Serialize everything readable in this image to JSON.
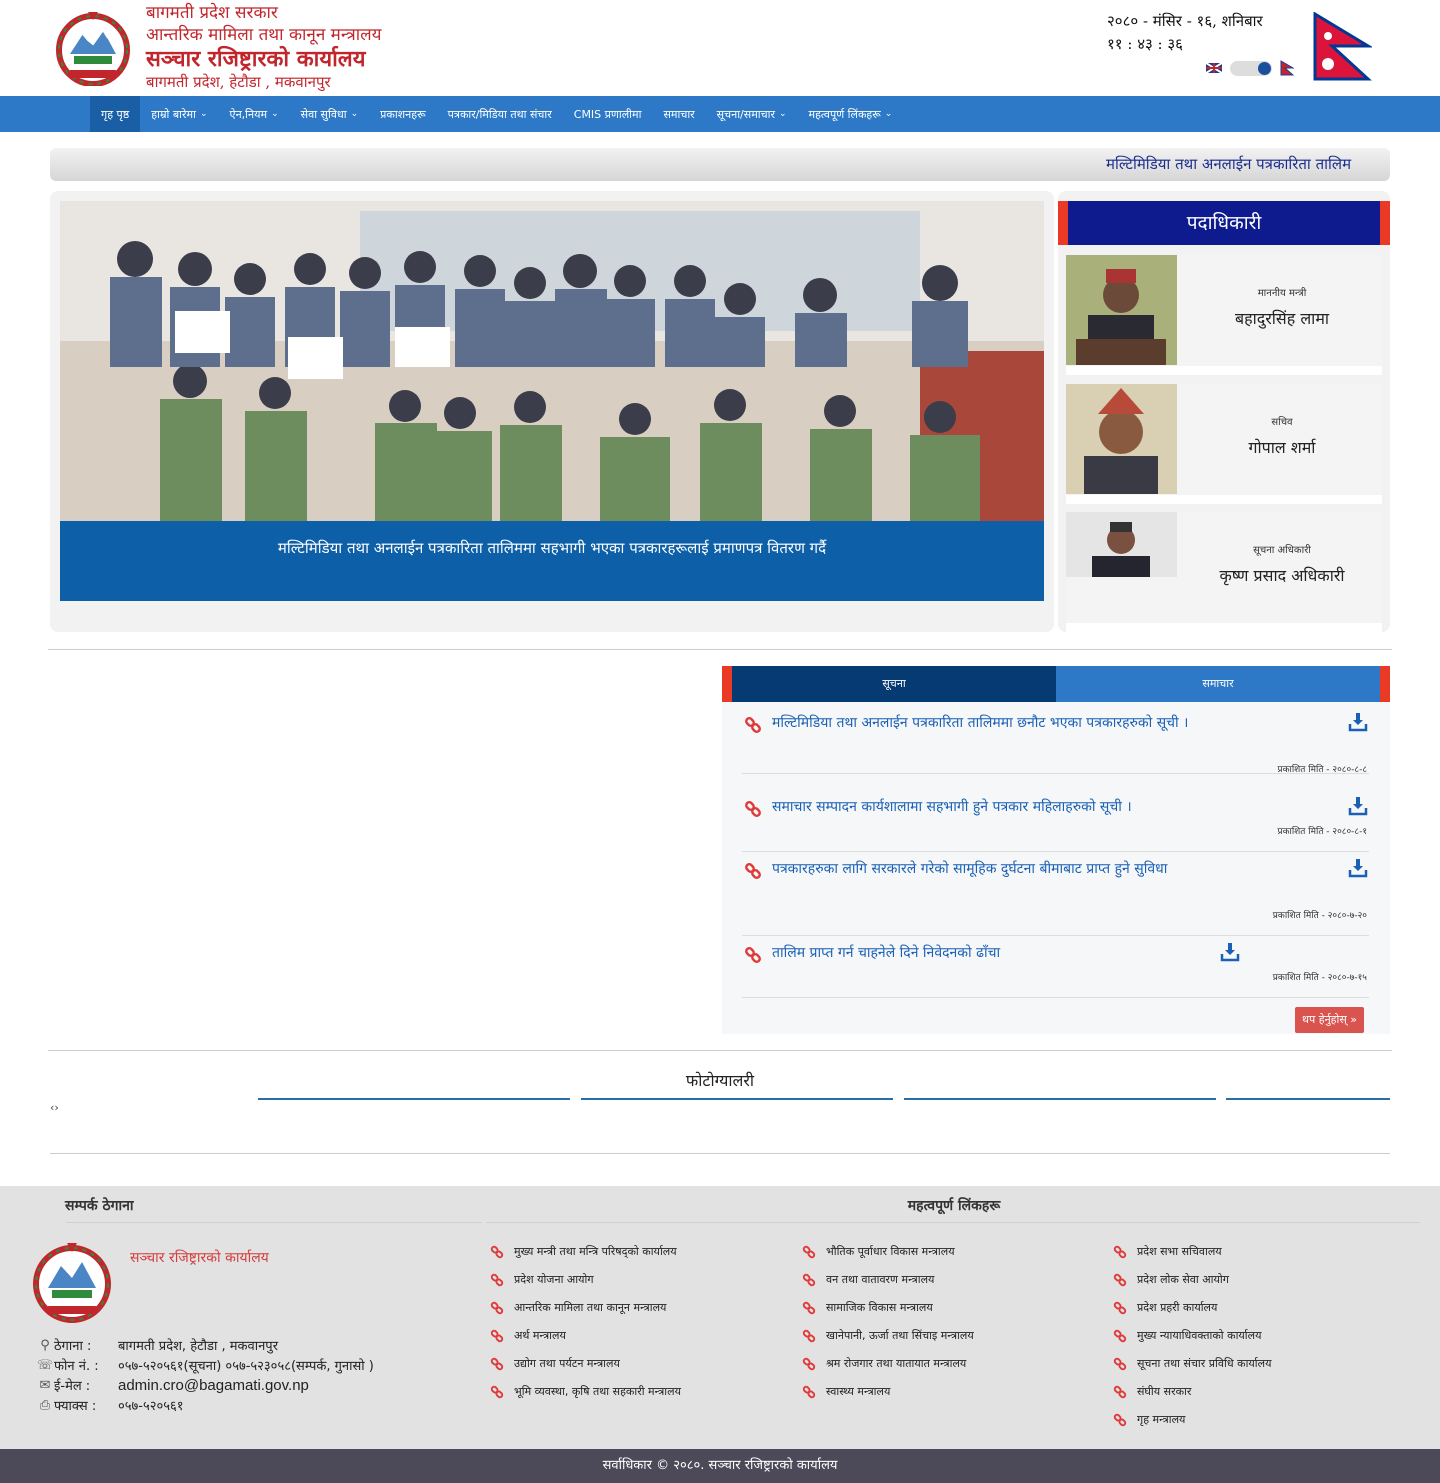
{
  "header": {
    "office_lines": [
      "बागमती प्रदेश सरकार",
      "आन्तरिक मामिला तथा कानून मन्त्रालय",
      "सञ्चार रजिष्ट्रारको कार्यालय",
      "बागमती प्रदेश, हेटौडा , मकवानपुर"
    ],
    "date": "२०८० - मंसिर - १६, शनिबार",
    "time": "११ : ४३ : ३६",
    "lang_left": "English",
    "lang_right": "नेपाली"
  },
  "nav": {
    "items": [
      {
        "label": "गृह पृष्ठ",
        "dropdown": false,
        "active": true
      },
      {
        "label": "हाम्रो बारेमा",
        "dropdown": true
      },
      {
        "label": "ऐन,नियम",
        "dropdown": true
      },
      {
        "label": "सेवा सुविधा",
        "dropdown": true
      },
      {
        "label": "प्रकाशनहरू",
        "dropdown": false
      },
      {
        "label": "पत्रकार/मिडिया तथा संचार",
        "dropdown": false
      },
      {
        "label": "CMIS प्रणालीमा",
        "dropdown": false
      },
      {
        "label": "समाचार",
        "dropdown": false
      },
      {
        "label": "सूचना/समाचार",
        "dropdown": true
      },
      {
        "label": "महत्वपूर्ण लिंकहरू",
        "dropdown": true
      }
    ]
  },
  "ticker": "मल्टिमिडिया तथा अनलाईन पत्रकारिता तालिम",
  "slider": {
    "caption": "मल्टिमिडिया तथा अनलाईन पत्रकारिता तालिममा सहभागी भएका पत्रकारहरूलाई प्रमाणपत्र वितरण गर्दै"
  },
  "officials": {
    "title": "पदाधिकारी",
    "people": [
      {
        "role": "माननीय मन्त्री",
        "name": "बहादुरसिंह लामा"
      },
      {
        "role": "सचिव",
        "name": "गोपाल शर्मा"
      },
      {
        "role": "सूचना अधिकारी",
        "name": "कृष्ण प्रसाद अधिकारी"
      }
    ]
  },
  "tabs": {
    "labels": [
      "सूचना",
      "समाचार"
    ],
    "notices": [
      {
        "title": "मल्टिमिडिया तथा अनलाईन पत्रकारिता तालिममा छनौट भएका पत्रकारहरुको सूची ।",
        "date": "प्रकाशित मिति - २०८०-८-८"
      },
      {
        "title": "समाचार सम्पादन कार्यशालामा सहभागी हुने पत्रकार महिलाहरुको सूची ।",
        "date": "प्रकाशित मिति - २०८०-८-१"
      },
      {
        "title": "पत्रकारहरुका लागि सरकारले गरेको सामूहिक दुर्घटना बीमाबाट प्राप्त हुने सुविधा",
        "date": "प्रकाशित मिति - २०८०-७-२०"
      },
      {
        "title": "तालिम प्राप्त गर्न चाहनेले दिने निवेदनको ढाँचा",
        "date": "प्रकाशित मिति - २०८०-७-१५"
      }
    ],
    "more_label": "थप हेर्नुहोस् »"
  },
  "gallery": {
    "title": "फोटोग्यालरी",
    "arrows": "‹›"
  },
  "footer": {
    "contact_title": "सम्पर्क ठेगाना",
    "links_title": "महत्वपूर्ण लिंकहरू",
    "office_name": "सञ्चार रजिष्ट्रारको कार्यालय",
    "contacts": [
      {
        "icon": "map-marker-icon",
        "label": "ठेगाना :",
        "value": "बागमती प्रदेश, हेटौडा , मकवानपुर"
      },
      {
        "icon": "phone-icon",
        "label": "फोन नं. :",
        "value": "०५७-५२०५६१(सूचना) ०५७-५२३०५८(सम्पर्क, गुनासो )"
      },
      {
        "icon": "envelope-icon",
        "label": "ई-मेल :",
        "value": "admin.cro@bagamati.gov.np"
      },
      {
        "icon": "fax-icon",
        "label": "फ्याक्स :",
        "value": "०५७-५२०५६१"
      }
    ],
    "links_col1": [
      "मुख्य मन्त्री तथा मन्त्रि परिषद्को कार्यालय",
      "प्रदेश योजना आयोग",
      "आन्तरिक मामिला तथा कानून मन्त्रालय",
      "अर्थ मन्त्रालय",
      "उद्योग तथा पर्यटन मन्त्रालय",
      "भूमि व्यवस्था, कृषि तथा सहकारी मन्त्रालय"
    ],
    "links_col2": [
      "भौतिक पूर्वाधार विकास मन्त्रालय",
      "वन तथा वातावरण मन्त्रालय",
      "सामाजिक विकास मन्त्रालय",
      "खानेपानी, ऊर्जा तथा सिंचाइ मन्त्रालय",
      "श्रम रोजगार तथा यातायात मन्त्रालय",
      "स्वास्थ्य मन्त्रालय"
    ],
    "links_col3": [
      "प्रदेश सभा सचिवालय",
      "प्रदेश लोक सेवा आयोग",
      "प्रदेश प्रहरी कार्यालय",
      "मुख्य न्यायाधिवक्ताको कार्यालय",
      "सूचना तथा संचार प्रविधि कार्यालय",
      "संघीय सरकार",
      "गृह मन्त्रालय"
    ]
  },
  "copyright": "सर्वाधिकार © २०८०. सञ्चार रजिष्ट्रारको कार्यालय",
  "colors": {
    "nav": "#2d79c7",
    "brand_red": "#c2262d",
    "officials_header": "#0d1b8f",
    "accent_red": "#ea3a25",
    "footer_bar": "#4c4a59"
  }
}
